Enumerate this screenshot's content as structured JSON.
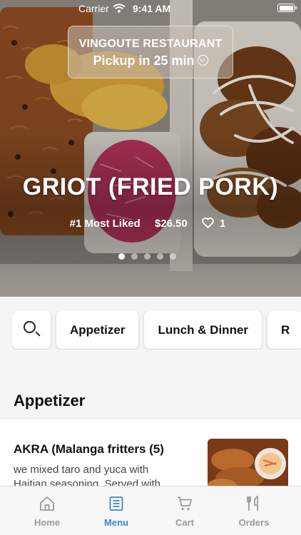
{
  "status_bar": {
    "carrier": "Carrier",
    "time": "9:41 AM"
  },
  "restaurant": {
    "name": "VINGOUTE RESTAURANT",
    "pickup": "Pickup in 25 min"
  },
  "featured": {
    "title": "GRIOT (FRIED PORK)",
    "rank": "#1 Most Liked",
    "price": "$26.50",
    "likes": "1",
    "slide_count": 5,
    "active_slide": 1
  },
  "categories": [
    {
      "label": "Appetizer"
    },
    {
      "label": "Lunch & Dinner"
    },
    {
      "label": "R"
    }
  ],
  "section": {
    "title": "Appetizer"
  },
  "menu_item": {
    "name": "AKRA (Malanga fritters (5)",
    "description_line1": "we mixed taro and yuca with",
    "description_line2": "Haitian seasoning. Served with..."
  },
  "tabs": [
    {
      "label": "Home",
      "icon": "home-icon"
    },
    {
      "label": "Menu",
      "icon": "menu-icon",
      "active": true
    },
    {
      "label": "Cart",
      "icon": "cart-icon"
    },
    {
      "label": "Orders",
      "icon": "orders-icon"
    }
  ],
  "colors": {
    "accent": "#3f86c4",
    "inactive_tab": "#9a9a9a"
  }
}
